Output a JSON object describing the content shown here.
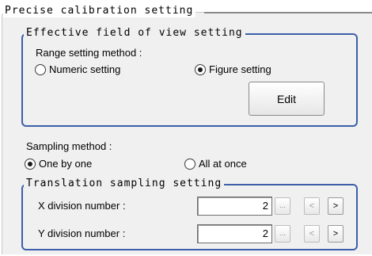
{
  "panel": {
    "title": "Precise calibration setting"
  },
  "fov_group": {
    "title": "Effective field of view setting",
    "range_label": "Range setting method :",
    "options": [
      {
        "label": "Numeric setting",
        "selected": false
      },
      {
        "label": "Figure setting",
        "selected": true
      }
    ],
    "edit_label": "Edit"
  },
  "sampling": {
    "label": "Sampling method :",
    "options": [
      {
        "label": "One by one",
        "selected": true
      },
      {
        "label": "All at once",
        "selected": false
      }
    ]
  },
  "translation_group": {
    "title": "Translation sampling setting",
    "x": {
      "label": "X division number :",
      "value": "2"
    },
    "y": {
      "label": "Y division number :",
      "value": "2"
    },
    "ellipsis_label": "...",
    "prev_label": "<",
    "next_label": ">"
  },
  "colors": {
    "group_border": "#3d5fa8",
    "panel_bg": "#f0f0f0"
  }
}
